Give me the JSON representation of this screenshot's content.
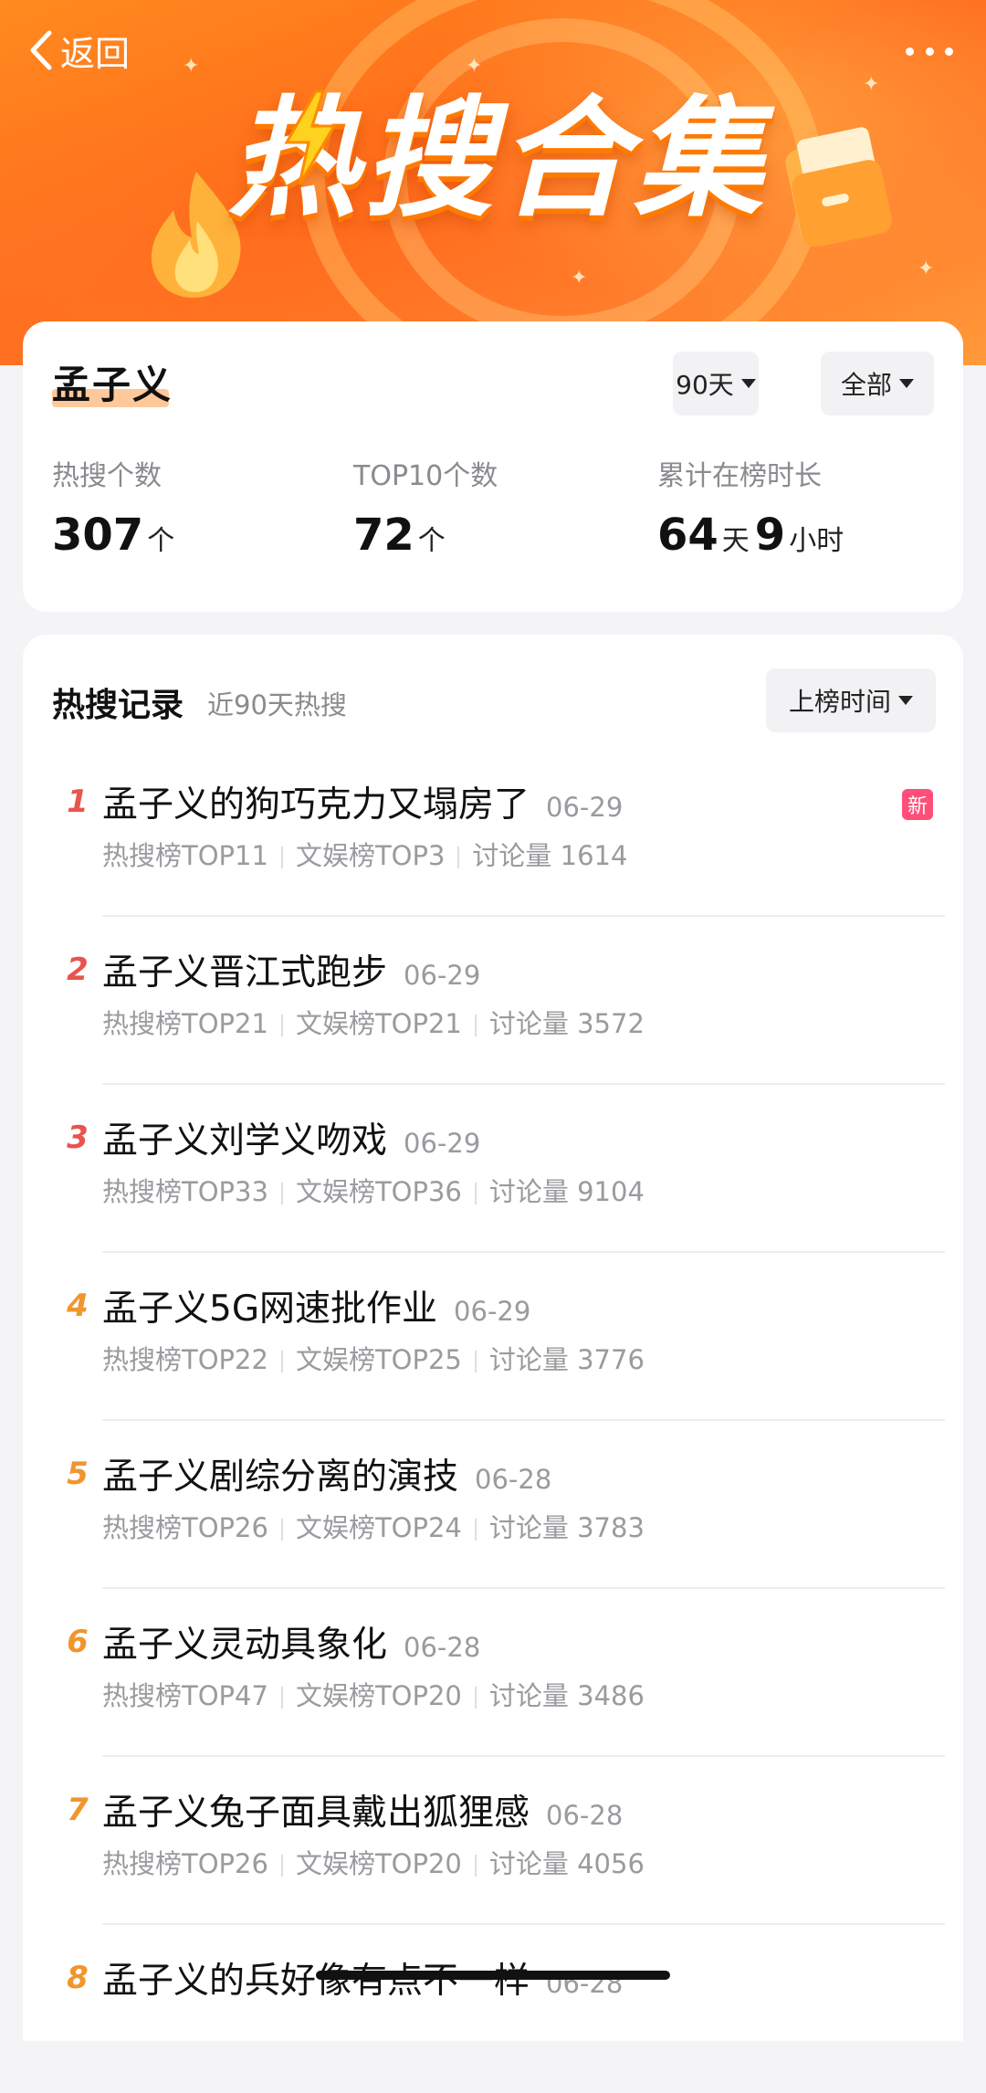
{
  "header": {
    "back_label": "返回",
    "banner_title": "热搜合集"
  },
  "summary": {
    "name": "孟子义",
    "range_filter": "90天",
    "type_filter": "全部",
    "stats": [
      {
        "label": "热搜个数",
        "parts": [
          {
            "num": "307",
            "unit": "个"
          }
        ]
      },
      {
        "label": "TOP10个数",
        "parts": [
          {
            "num": "72",
            "unit": "个"
          }
        ]
      },
      {
        "label": "累计在榜时长",
        "parts": [
          {
            "num": "64",
            "unit": "天"
          },
          {
            "num": "9",
            "unit": "小时"
          }
        ]
      }
    ]
  },
  "records": {
    "title": "热搜记录",
    "subtitle": "近90天热搜",
    "sort_label": "上榜时间",
    "new_badge": "新",
    "items": [
      {
        "rank": "1",
        "title": "孟子义的狗巧克力又塌房了",
        "date": "06-29",
        "hot": "热搜榜TOP11",
        "ent": "文娱榜TOP3",
        "discuss": "讨论量 1614",
        "color": "#e8544e"
      },
      {
        "rank": "2",
        "title": "孟子义晋江式跑步",
        "date": "06-29",
        "hot": "热搜榜TOP21",
        "ent": "文娱榜TOP21",
        "discuss": "讨论量 3572",
        "color": "#e8544e"
      },
      {
        "rank": "3",
        "title": "孟子义刘学义吻戏",
        "date": "06-29",
        "hot": "热搜榜TOP33",
        "ent": "文娱榜TOP36",
        "discuss": "讨论量 9104",
        "color": "#e8544e"
      },
      {
        "rank": "4",
        "title": "孟子义5G网速批作业",
        "date": "06-29",
        "hot": "热搜榜TOP22",
        "ent": "文娱榜TOP25",
        "discuss": "讨论量 3776",
        "color": "#f0962e"
      },
      {
        "rank": "5",
        "title": "孟子义剧综分离的演技",
        "date": "06-28",
        "hot": "热搜榜TOP26",
        "ent": "文娱榜TOP24",
        "discuss": "讨论量 3783",
        "color": "#f0962e"
      },
      {
        "rank": "6",
        "title": "孟子义灵动具象化",
        "date": "06-28",
        "hot": "热搜榜TOP47",
        "ent": "文娱榜TOP20",
        "discuss": "讨论量 3486",
        "color": "#f0962e"
      },
      {
        "rank": "7",
        "title": "孟子义兔子面具戴出狐狸感",
        "date": "06-28",
        "hot": "热搜榜TOP26",
        "ent": "文娱榜TOP20",
        "discuss": "讨论量 4056",
        "color": "#f0962e"
      },
      {
        "rank": "8",
        "title": "孟子义的兵好像有点不一样",
        "date": "06-28",
        "hot": "",
        "ent": "",
        "discuss": "",
        "color": "#f0962e"
      }
    ]
  }
}
